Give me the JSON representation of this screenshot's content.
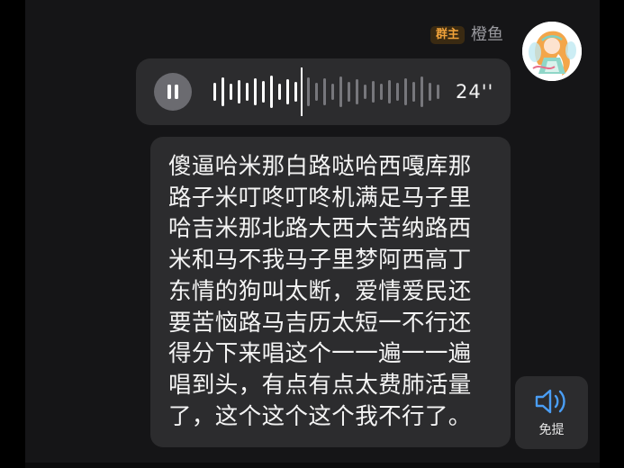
{
  "sender": {
    "role_badge": "群主",
    "name": "橙鱼"
  },
  "voice_message": {
    "duration": "24''"
  },
  "transcript": {
    "lines": [
      "傻逼哈米那白路哒哈西嘎库那",
      "路子米叮咚叮咚机满足马子里",
      "哈吉米那北路大西大苦纳路西",
      "米和马不我马子里梦阿西高丁",
      "东情的狗叫太断，爱情爱民还",
      "要苦恼路马吉历太短一不行还",
      "得分下来唱这个一一遍一一遍",
      "唱到头，有点有点太费肺活量",
      "了，这个这个这个我不行了。"
    ]
  },
  "speaker_button": {
    "label": "免提",
    "icon": "speaker-icon"
  },
  "colors": {
    "accent_badge": "#f0a23a",
    "speaker_icon": "#4a9ef5",
    "bubble": "#2c2c2e"
  }
}
